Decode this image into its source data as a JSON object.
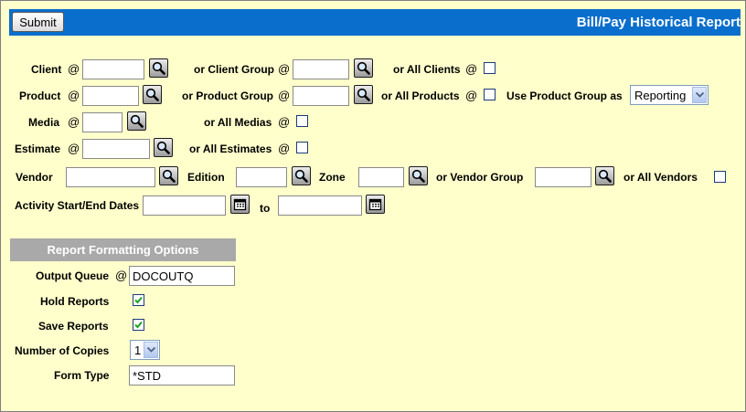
{
  "header": {
    "submit_label": "Submit",
    "title": "Bill/Pay Historical Report"
  },
  "at_symbol": "@",
  "client": {
    "label": "Client",
    "value": "",
    "group_label": "or Client Group",
    "group_value": "",
    "all_label": "or All Clients",
    "all_checked": false
  },
  "product": {
    "label": "Product",
    "value": "",
    "group_label": "or Product Group",
    "group_value": "",
    "all_label": "or All Products",
    "all_checked": false,
    "use_group_label": "Use Product Group as",
    "use_group_selected": "Reporting"
  },
  "media": {
    "label": "Media",
    "value": "",
    "all_label": "or All Medias",
    "all_checked": false
  },
  "estimate": {
    "label": "Estimate",
    "value": "",
    "all_label": "or All Estimates",
    "all_checked": false
  },
  "vendor": {
    "label": "Vendor",
    "value": "",
    "edition_label": "Edition",
    "edition_value": "",
    "zone_label": "Zone",
    "zone_value": "",
    "group_label": "or Vendor Group",
    "group_value": "",
    "all_label": "or All Vendors",
    "all_checked": false
  },
  "activity": {
    "label": "Activity Start/End Dates",
    "start_value": "",
    "to_label": "to",
    "end_value": ""
  },
  "formatting": {
    "header": "Report Formatting Options",
    "output_queue_label": "Output Queue",
    "output_queue_value": "DOCOUTQ",
    "hold_reports_label": "Hold Reports",
    "hold_reports_checked": true,
    "save_reports_label": "Save Reports",
    "save_reports_checked": true,
    "copies_label": "Number of Copies",
    "copies_selected": "1",
    "form_type_label": "Form Type",
    "form_type_value": "*STD"
  }
}
